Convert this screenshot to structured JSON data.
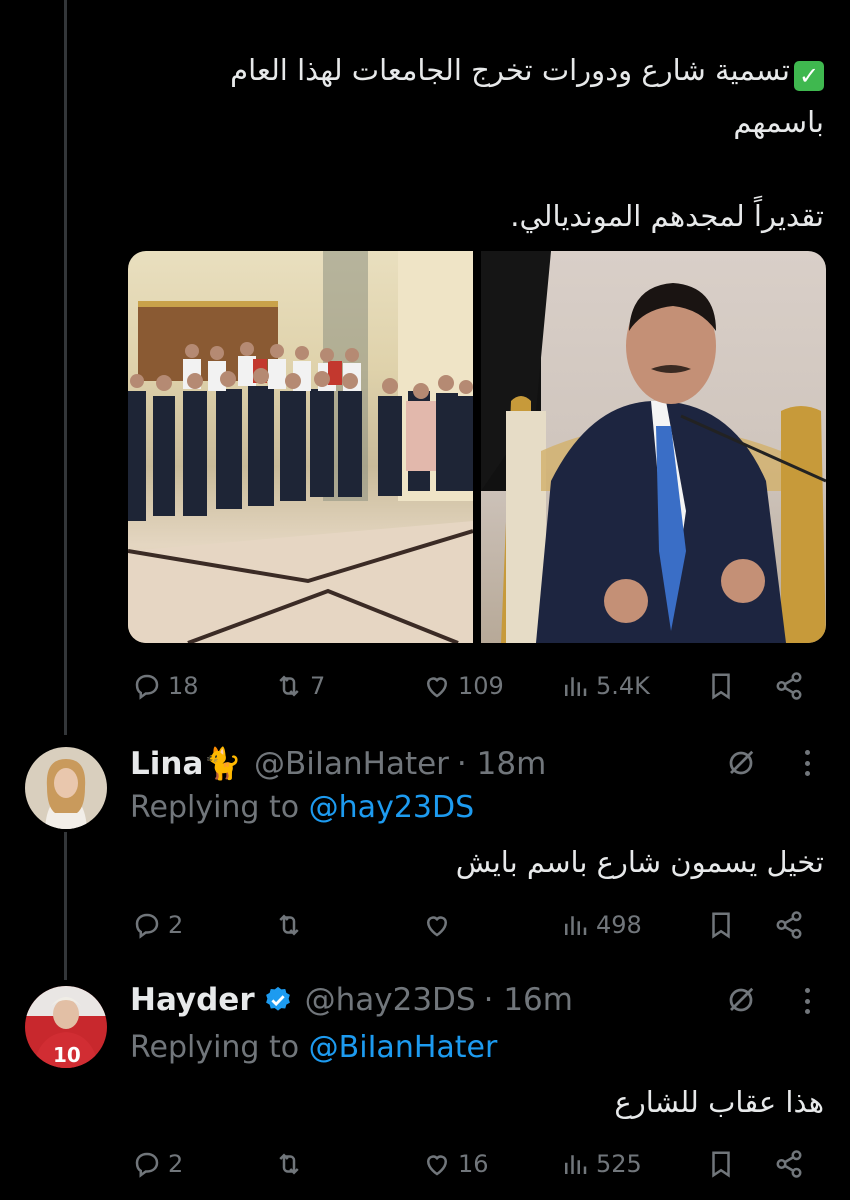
{
  "main_tweet": {
    "line1": "تسمية شارع ودورات تخرج الجامعات لهذا العام",
    "line2": "باسمهم",
    "line3": "تقديراً لمجدهم المونديالي.",
    "check_emoji": "✓",
    "stats": {
      "replies": "18",
      "retweets": "7",
      "likes": "109",
      "views": "5.4K"
    }
  },
  "replies": [
    {
      "name": "Lina🐈",
      "handle": "@BiIanHater",
      "time": "· 18m",
      "replying_label": "Replying to ",
      "replying_to": "@hay23DS",
      "text": "تخيل يسمون شارع باسم بايش",
      "stats": {
        "replies": "2",
        "retweets": "",
        "likes": "",
        "views": "498"
      }
    },
    {
      "name": "Hayder",
      "handle": "@hay23DS",
      "time": "· 16m",
      "verified": true,
      "replying_label": "Replying to ",
      "replying_to": "@BiIanHater",
      "text": "هذا عقاب للشارع",
      "stats": {
        "replies": "2",
        "retweets": "",
        "likes": "16",
        "views": "525"
      }
    }
  ],
  "icons": {
    "reply": "reply-icon",
    "retweet": "retweet-icon",
    "like": "heart-icon",
    "views": "views-icon",
    "bookmark": "bookmark-icon",
    "share": "share-icon",
    "grok": "grok-icon",
    "more": "more-icon",
    "verified": "verified-badge-icon"
  },
  "colors": {
    "background": "#000000",
    "text": "#e7e9ea",
    "muted": "#71767b",
    "link": "#1d9bf0",
    "check": "#3fb84f"
  }
}
